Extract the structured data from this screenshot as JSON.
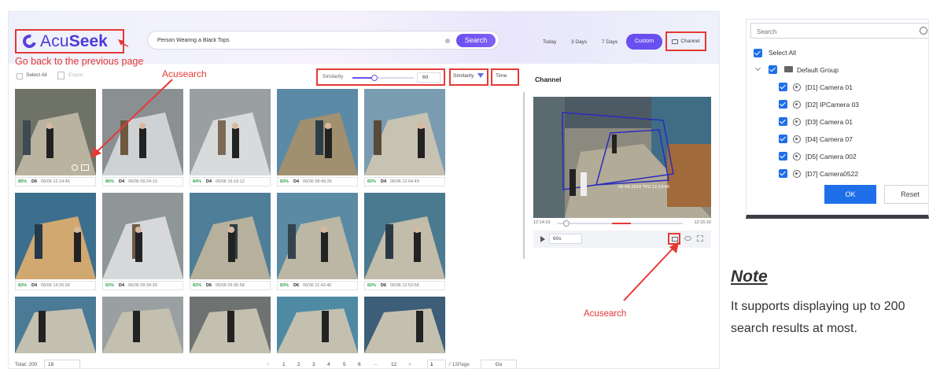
{
  "header": {
    "logo_left": "Acu",
    "logo_right": "Seek",
    "back_note": "Go back to the previous page",
    "search_value": "Person Wearing a Black Tops",
    "search_button": "Search",
    "date_tabs": [
      "Today",
      "3 Days",
      "7 Days"
    ],
    "custom_tab": "Custom",
    "channel_button": "Channel"
  },
  "toolbar": {
    "select_all": "Select All",
    "export": "Export",
    "acusearch_note": "Acusearch",
    "similarity_label": "Similarity",
    "similarity_value": "60",
    "similarity_level": 0.6,
    "sort_similarity": "Similarity",
    "sort_time": "Time"
  },
  "results": [
    {
      "pct": "85%",
      "ch": "D6",
      "time": "06/06 12:14:46"
    },
    {
      "pct": "85%",
      "ch": "D4",
      "time": "06/06 09:24:10"
    },
    {
      "pct": "84%",
      "ch": "D4",
      "time": "06/06 15:19:12"
    },
    {
      "pct": "83%",
      "ch": "D4",
      "time": "06/06 08:49:36"
    },
    {
      "pct": "83%",
      "ch": "D4",
      "time": "06/06 12:04:49"
    },
    {
      "pct": "83%",
      "ch": "D4",
      "time": "06/06 14:20:30"
    },
    {
      "pct": "83%",
      "ch": "D4",
      "time": "06/06 09:34:39"
    },
    {
      "pct": "83%",
      "ch": "D6",
      "time": "06/06 09:35:58"
    },
    {
      "pct": "83%",
      "ch": "D6",
      "time": "06/06 11:43:46"
    },
    {
      "pct": "83%",
      "ch": "D6",
      "time": "06/06 12:53:58"
    }
  ],
  "footer": {
    "total": "Total: 200",
    "page_size": "18",
    "pages": [
      "1",
      "2",
      "3",
      "4",
      "5",
      "6",
      "···",
      "12"
    ],
    "prev": "<",
    "next": ">",
    "page_input": "1",
    "page_total": "/ 12Page",
    "go": "Go"
  },
  "channel_panel": {
    "title": "Channel",
    "overlay_text": "06-06-2024 THU 12:14:46",
    "time_start": "12:14:16",
    "time_end": "12:15:16",
    "speed": "60s",
    "acusearch_note": "Acusearch"
  },
  "dropdown": {
    "search_placeholder": "Search",
    "select_all": "Select All",
    "group": "Default Group",
    "cameras": [
      "[D1] Camera 01",
      "[D2] IPCamera 03",
      "[D3] Camera 01",
      "[D4] Camera 07",
      "[D5] Camera 002",
      "[D7] Camera0522"
    ],
    "ok": "OK",
    "reset": "Reset"
  },
  "note": {
    "title": "Note",
    "text": "It supports displaying up to 200 search results at most."
  },
  "colors": {
    "accent": "#6a4ff0",
    "annotation": "#e53935",
    "checkbox": "#1e6fe8",
    "match": "#2ea44f"
  }
}
